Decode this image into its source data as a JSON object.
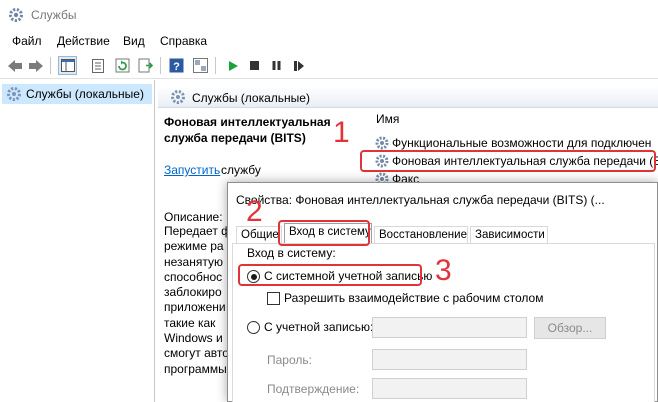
{
  "window": {
    "title": "Службы"
  },
  "menu": {
    "items": [
      "Файл",
      "Действие",
      "Вид",
      "Справка"
    ]
  },
  "tree": {
    "root_label": "Службы (локальные)"
  },
  "pane": {
    "header": "Службы (локальные)"
  },
  "details": {
    "service_title": "Фоновая интеллектуальная служба передачи (BITS)",
    "start_link": "Запустить",
    "start_rest": " службу",
    "description_label": "Описание:",
    "description_text": "Передает ф\nрежиме ра\nнезанятую\nспособнос\nзаблокиро\nприложени\nтакие как \nWindows и\nсмогут авто\nпрограммы"
  },
  "list": {
    "column_name": "Имя",
    "rows": [
      "Функциональные возможности для подключен",
      "Фоновая интеллектуальная служба передачи (BITS)",
      "Факс"
    ]
  },
  "dialog": {
    "title": "Свойства: Фоновая интеллектуальная служба передачи (BITS) (...",
    "tabs": [
      "Общие",
      "Вход в систему",
      "Восстановление",
      "Зависимости"
    ],
    "active_tab": 1,
    "logon_group_label": "Вход в систему:",
    "system_account_label": "С системной учетной записью",
    "allow_desktop_label": "Разрешить взаимодействие с рабочим столом",
    "this_account_label": "С учетной записью:",
    "browse_label": "Обзор...",
    "password_label": "Пароль:",
    "confirm_label": "Подтверждение:"
  },
  "annotations": {
    "n1": "1",
    "n2": "2",
    "n3": "3"
  },
  "colors": {
    "annotation": "#e0333a",
    "selection": "#cce8ff",
    "link": "#0066cc"
  }
}
